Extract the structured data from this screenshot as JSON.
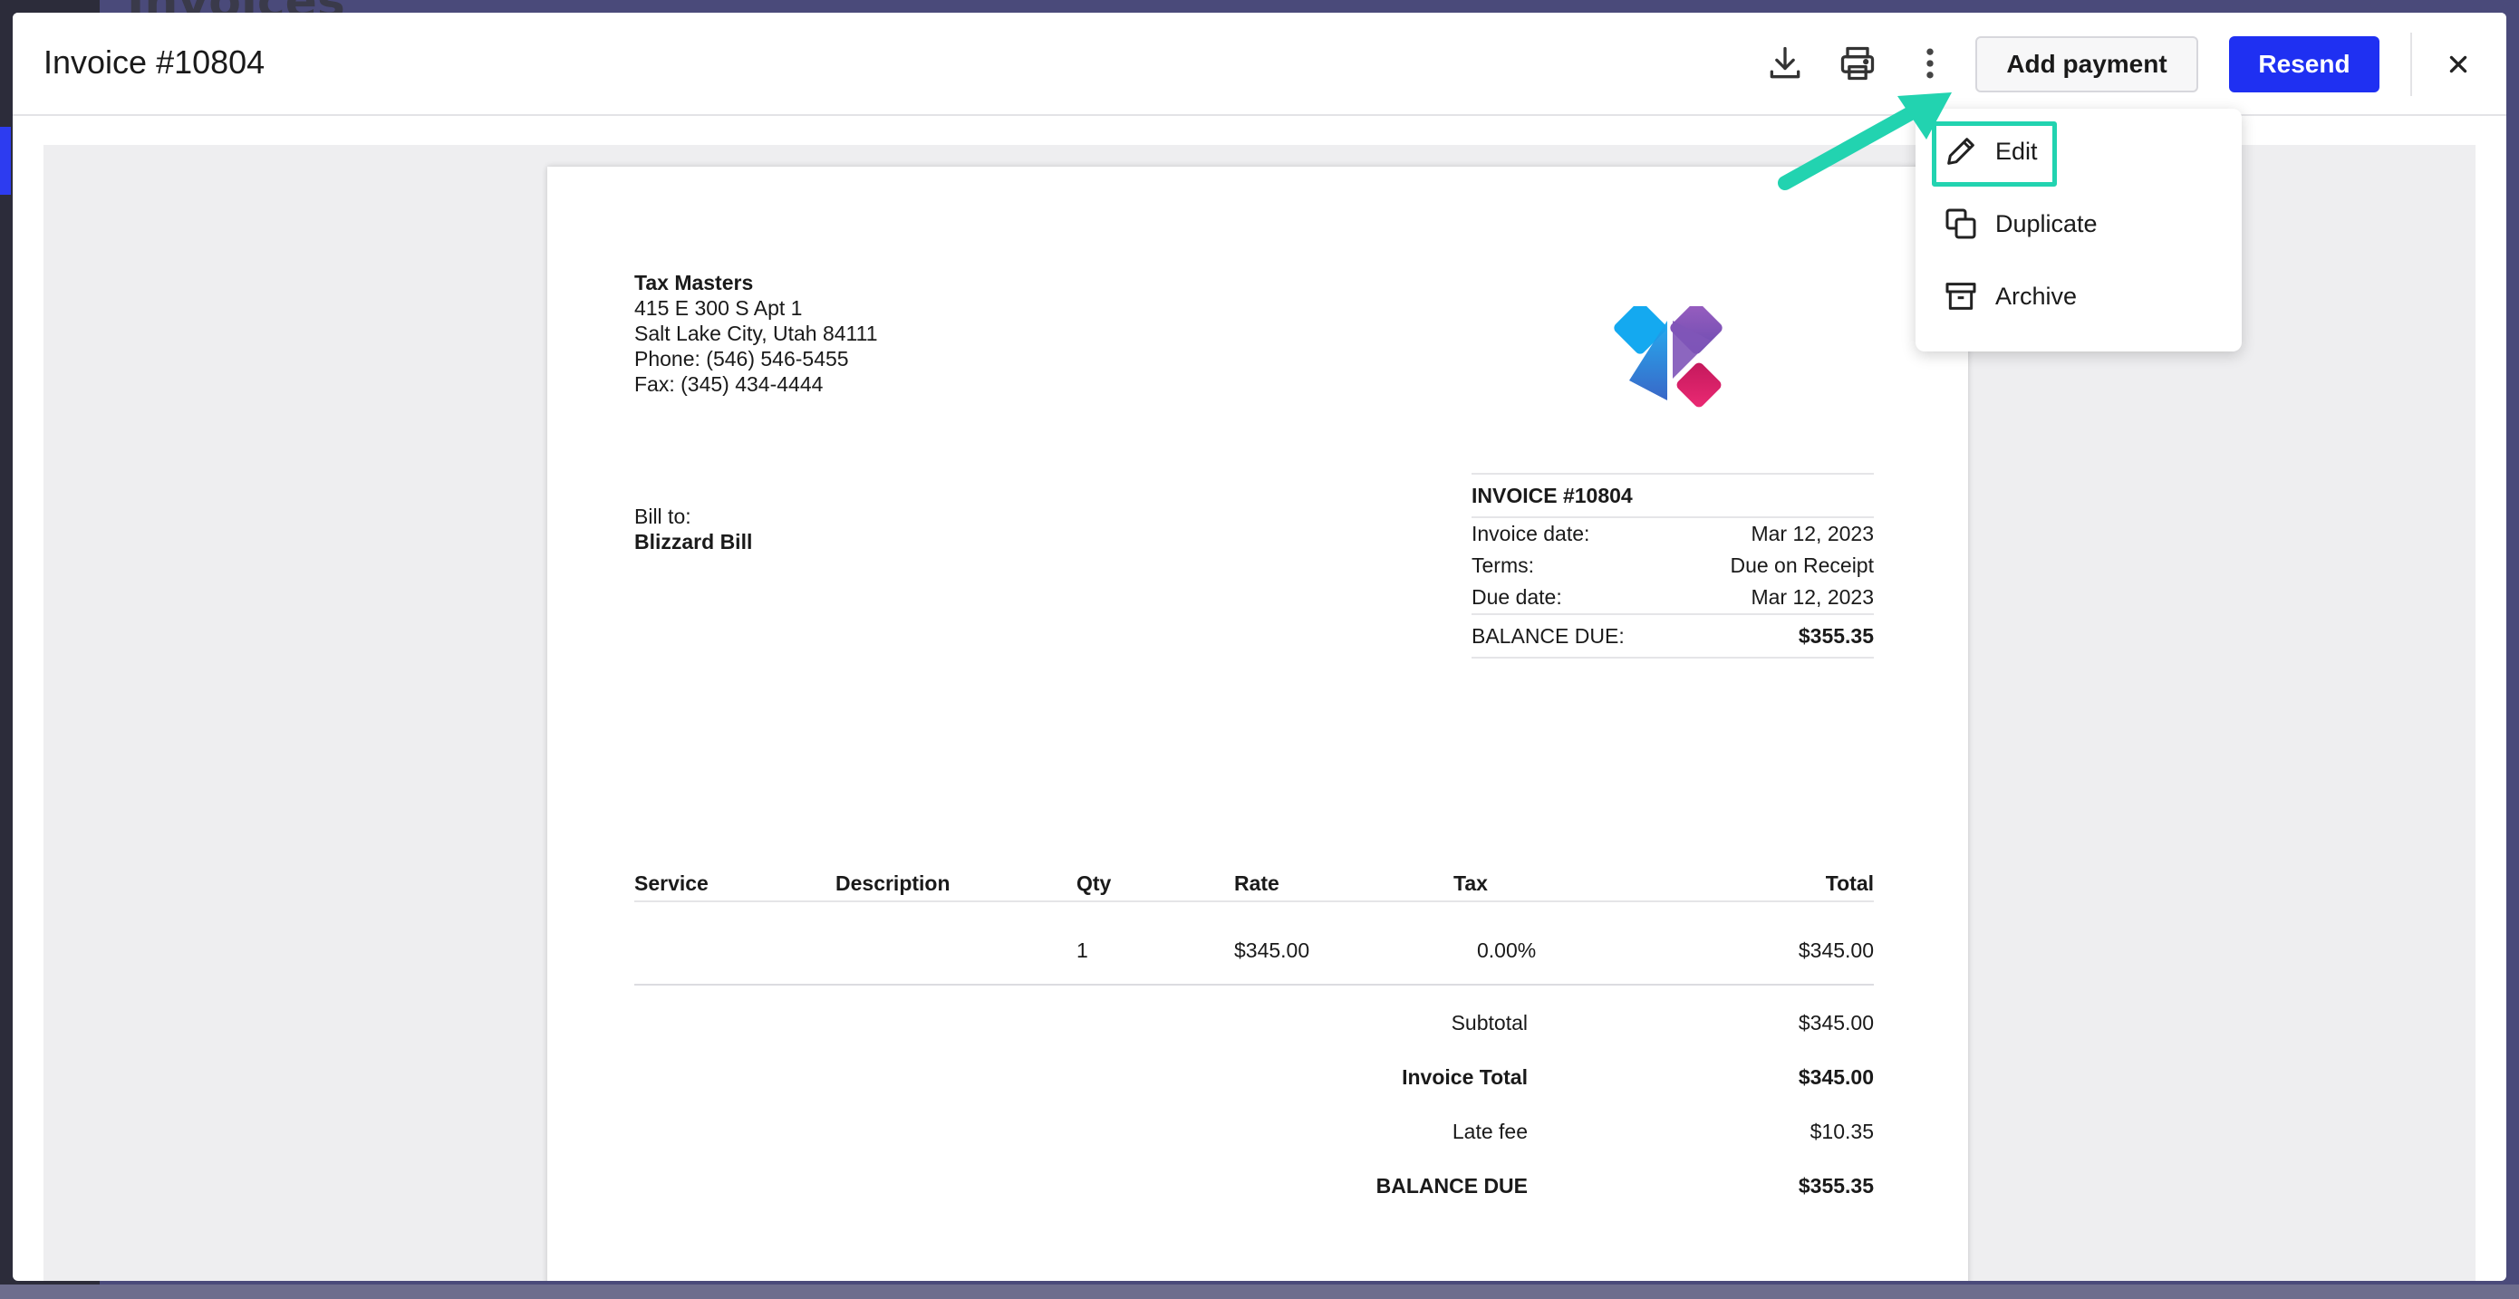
{
  "background": {
    "page_title": "Invoices"
  },
  "modal": {
    "title": "Invoice #10804",
    "actions": {
      "download_icon": "download-icon",
      "print_icon": "printer-icon",
      "more_icon": "more-vertical-icon",
      "add_payment_label": "Add payment",
      "resend_label": "Resend",
      "close_icon": "close-icon"
    }
  },
  "menu": {
    "items": [
      {
        "label": "Edit",
        "icon": "pencil-icon"
      },
      {
        "label": "Duplicate",
        "icon": "duplicate-icon"
      },
      {
        "label": "Archive",
        "icon": "archive-icon"
      }
    ],
    "highlight_color": "#22d3b0"
  },
  "invoice": {
    "company": {
      "name": "Tax Masters",
      "address1": "415 E 300 S Apt 1",
      "address2": "Salt Lake City, Utah 84111",
      "phone": "Phone: (546) 546-5455",
      "fax": "Fax: (345) 434-4444"
    },
    "bill_to_label": "Bill to:",
    "client": "Blizzard Bill",
    "meta": {
      "title": "INVOICE #10804",
      "invoice_date_label": "Invoice date:",
      "invoice_date": "Mar 12, 2023",
      "terms_label": "Terms:",
      "terms": "Due on Receipt",
      "due_date_label": "Due date:",
      "due_date": "Mar 12, 2023",
      "balance_label": "BALANCE DUE:",
      "balance": "$355.35"
    },
    "table": {
      "headers": {
        "service": "Service",
        "description": "Description",
        "qty": "Qty",
        "rate": "Rate",
        "tax": "Tax",
        "total": "Total"
      },
      "rows": [
        {
          "service": "",
          "description": "",
          "qty": "1",
          "rate": "$345.00",
          "tax": "0.00%",
          "total": "$345.00"
        }
      ]
    },
    "totals": {
      "subtotal_label": "Subtotal",
      "subtotal": "$345.00",
      "invoice_total_label": "Invoice Total",
      "invoice_total": "$345.00",
      "late_fee_label": "Late fee",
      "late_fee": "$10.35",
      "balance_due_label": "BALANCE DUE",
      "balance_due": "$355.35"
    }
  },
  "colors": {
    "primary": "#1f30f2",
    "annotation": "#22d3b0"
  }
}
